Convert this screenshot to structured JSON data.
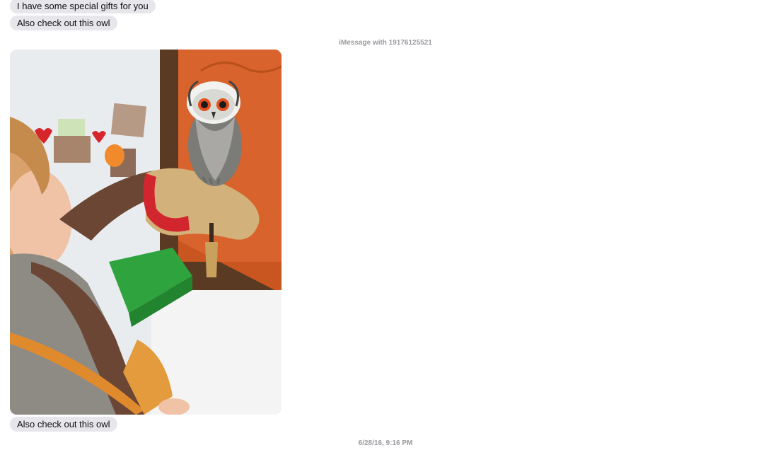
{
  "messages": [
    {
      "text": "I have some special gifts for you"
    },
    {
      "text": "Also check out this owl"
    },
    {
      "text": "Also check out this owl"
    }
  ],
  "meta": {
    "imessage_with": "iMessage with 19176125521",
    "timestamp": "6/28/16, 9:16 PM"
  }
}
